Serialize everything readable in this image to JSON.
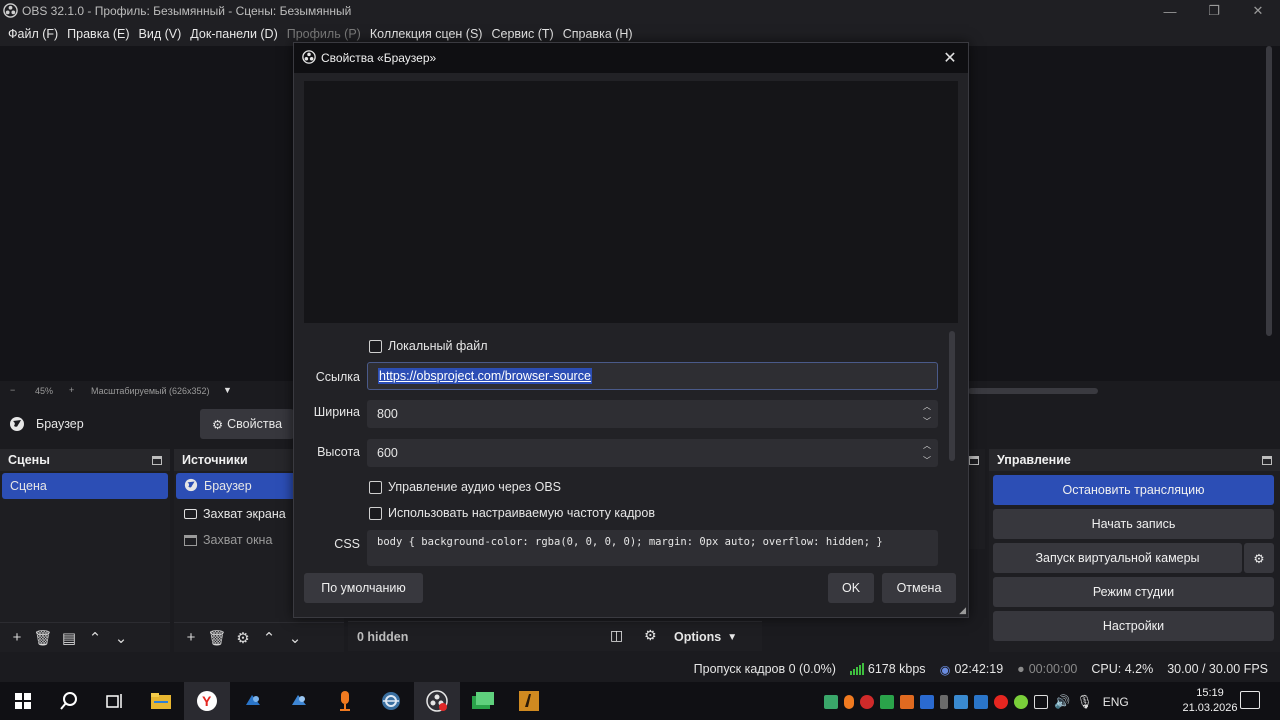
{
  "window": {
    "title": "OBS 32.1.0 - Профиль: Безымянный - Сцены: Безымянный",
    "minimize": "—",
    "maximize": "❐",
    "close": "✕"
  },
  "menu": [
    {
      "label": "Файл (F)",
      "enabled": true
    },
    {
      "label": "Правка (E)",
      "enabled": true
    },
    {
      "label": "Вид (V)",
      "enabled": true
    },
    {
      "label": "Док-панели (D)",
      "enabled": true
    },
    {
      "label": "Профиль (P)",
      "enabled": false
    },
    {
      "label": "Коллекция сцен (S)",
      "enabled": true
    },
    {
      "label": "Сервис (T)",
      "enabled": true
    },
    {
      "label": "Справка (H)",
      "enabled": true
    }
  ],
  "zoom": {
    "minus": "−",
    "value": "45%",
    "plus": "+",
    "mode": "Масштабируемый (626x352)"
  },
  "source_toolbar": {
    "selected_source": "Браузер",
    "properties_label": "Свойства"
  },
  "scenes": {
    "title": "Сцены",
    "items": [
      "Сцена"
    ]
  },
  "sources": {
    "title": "Источники",
    "items": [
      {
        "label": "Браузер",
        "icon": "globe-icon",
        "selected": true
      },
      {
        "label": "Захват экрана",
        "icon": "monitor-icon",
        "selected": false
      },
      {
        "label": "Захват окна",
        "icon": "window-icon",
        "selected": false
      }
    ]
  },
  "mixer_bar": {
    "hidden_label": "0 hidden",
    "options_label": "Options"
  },
  "controls": {
    "title": "Управление",
    "stop_stream": "Остановить трансляцию",
    "start_recording": "Начать запись",
    "virtual_camera": "Запуск виртуальной камеры",
    "studio_mode": "Режим студии",
    "settings": "Настройки"
  },
  "status": {
    "dropped_frames": "Пропуск кадров 0 (0.0%)",
    "bitrate": "6178 kbps",
    "stream_time": "02:42:19",
    "record_time": "00:00:00",
    "cpu": "CPU: 4.2%",
    "fps": "30.00 / 30.00 FPS"
  },
  "dialog": {
    "title": "Свойства «Браузер»",
    "local_file_label": "Локальный файл",
    "local_file_checked": false,
    "url_label": "Ссылка",
    "url_value": "https://obsproject.com/browser-source",
    "width_label": "Ширина",
    "width_value": "800",
    "height_label": "Высота",
    "height_value": "600",
    "audio_control_label": "Управление аудио через OBS",
    "audio_control_checked": false,
    "custom_fps_label": "Использовать настраиваемую частоту кадров",
    "custom_fps_checked": false,
    "css_label": "CSS",
    "css_value": "body { background-color: rgba(0, 0, 0, 0); margin: 0px auto; overflow: hidden; }",
    "defaults_button": "По умолчанию",
    "ok_button": "OK",
    "cancel_button": "Отмена"
  },
  "taskbar": {
    "apps": [
      "start-icon",
      "search-icon",
      "task-view-icon",
      "file-explorer-icon",
      "yandex-browser-icon",
      "steam-icon",
      "steam-icon",
      "app-orange-icon",
      "app-globe-icon",
      "obs-icon",
      "app-green-icon",
      "game-icon"
    ],
    "language": "ENG",
    "time": "15:19",
    "date": "21.03.2026"
  },
  "colors": {
    "accent": "#2c4eb5",
    "background": "#1b1b1f",
    "panel": "#1e1e22",
    "button": "#37373d"
  }
}
